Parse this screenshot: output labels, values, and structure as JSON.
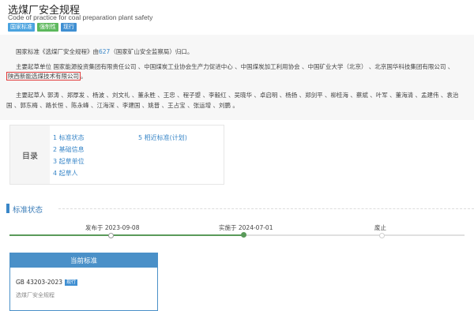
{
  "header": {
    "title": "选煤厂安全规程",
    "subtitle": "Code of practice for coal preparation plant safety",
    "badges": [
      "国家标准",
      "强制性",
      "现行"
    ]
  },
  "content": {
    "p1_a": "国家标准《选煤厂安全规程》由",
    "p1_link": "627",
    "p1_b": "（国家矿山安全监察局）归口。",
    "p2_line1": "主要起草单位 国家能源投资集团有限责任公司 、中国煤炭工业协会生产力促进中心 、中国煤炭加工利用协会 、中国矿业大学（北京） 、北京国华科技集团有限公司 、",
    "p2_highlight": "陕西新能选煤技术有限公司",
    "p2_end": "。",
    "p3_line1": "主要起草人 郭涛 、郑厚发 、杨波 、刘文礼 、董永胜 、王忠 、程子曌 、李毅红 、吴晓华 、卓启明 、杨扬 、郑剑平 、柳桂海 、蔡斌 、叶军 、董海清 、孟建伟 、袁治",
    "p3_line2": "国 、郭东梅 、路长恒 、陈永峰 、江海深 、李建国 、姚普 、王占宝 、张运增 、刘鹏 。"
  },
  "toc": {
    "heading": "目录",
    "items": [
      "1 标准状态",
      "2 基础信息",
      "3 起草单位",
      "4 起草人",
      "5 相近标准(计划)"
    ]
  },
  "status": {
    "section_title": "标准状态",
    "timeline": [
      "发布于 2023-09-08",
      "实施于 2024-07-01",
      "废止"
    ],
    "card": {
      "head": "当前标准",
      "code": "GB 43203-2023",
      "badge": "现行",
      "name": "选煤厂安全规程"
    }
  },
  "colors": {
    "accent": "#3a87c8",
    "timeline_done": "#5a9a5a",
    "highlight_border": "#e23b3b"
  }
}
